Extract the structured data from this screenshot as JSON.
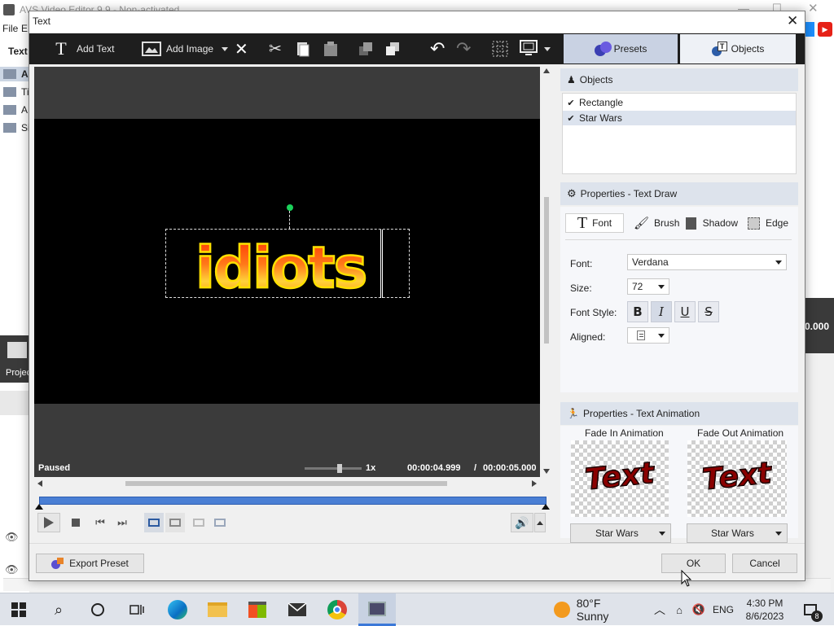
{
  "background_app": {
    "title": "AVS Video Editor 9.9 - Non-activated",
    "menu": [
      "File",
      "E"
    ],
    "side_label": "Text",
    "side_items": [
      "A",
      "Ti",
      "A",
      "Si"
    ],
    "project_label": "Projec",
    "time_fragment": "0.000"
  },
  "dialog": {
    "title": "Text",
    "toolbar": {
      "add_text": "Add Text",
      "add_image": "Add Image"
    },
    "tabs": {
      "presets": "Presets",
      "objects": "Objects"
    },
    "preview": {
      "text": "idiots",
      "status": "Paused",
      "speed": "1x",
      "time_current": "00:00:04.999",
      "time_separator": "/",
      "time_total": "00:00:05.000"
    },
    "objects_panel": {
      "header": "Objects",
      "items": [
        {
          "label": "Rectangle",
          "checked": true
        },
        {
          "label": "Star Wars",
          "checked": true
        }
      ]
    },
    "properties_panel": {
      "header": "Properties - Text Draw",
      "tabs": [
        "Font",
        "Brush",
        "Shadow",
        "Edge"
      ],
      "font_label": "Font:",
      "font_value": "Verdana",
      "size_label": "Size:",
      "size_value": "72",
      "style_label": "Font Style:",
      "style_buttons": [
        "B",
        "I",
        "U",
        "S"
      ],
      "aligned_label": "Aligned:"
    },
    "animation_panel": {
      "header": "Properties - Text Animation",
      "fade_in_label": "Fade In Animation",
      "fade_out_label": "Fade Out Animation",
      "preview_text": "Text",
      "fade_in_value": "Star Wars",
      "fade_out_value": "Star Wars"
    },
    "buttons": {
      "export_preset": "Export Preset",
      "ok": "OK",
      "cancel": "Cancel"
    }
  },
  "taskbar": {
    "weather": "80°F  Sunny",
    "language": "ENG",
    "time": "4:30 PM",
    "date": "8/6/2023",
    "notification_count": "8"
  },
  "colors": {
    "accent_blue": "#4a7fd4",
    "toolbar_dark": "#1e1e1e",
    "panel_header": "#dde3ec",
    "text_fill_start": "#ff3a00",
    "text_fill_end": "#ffe000"
  }
}
